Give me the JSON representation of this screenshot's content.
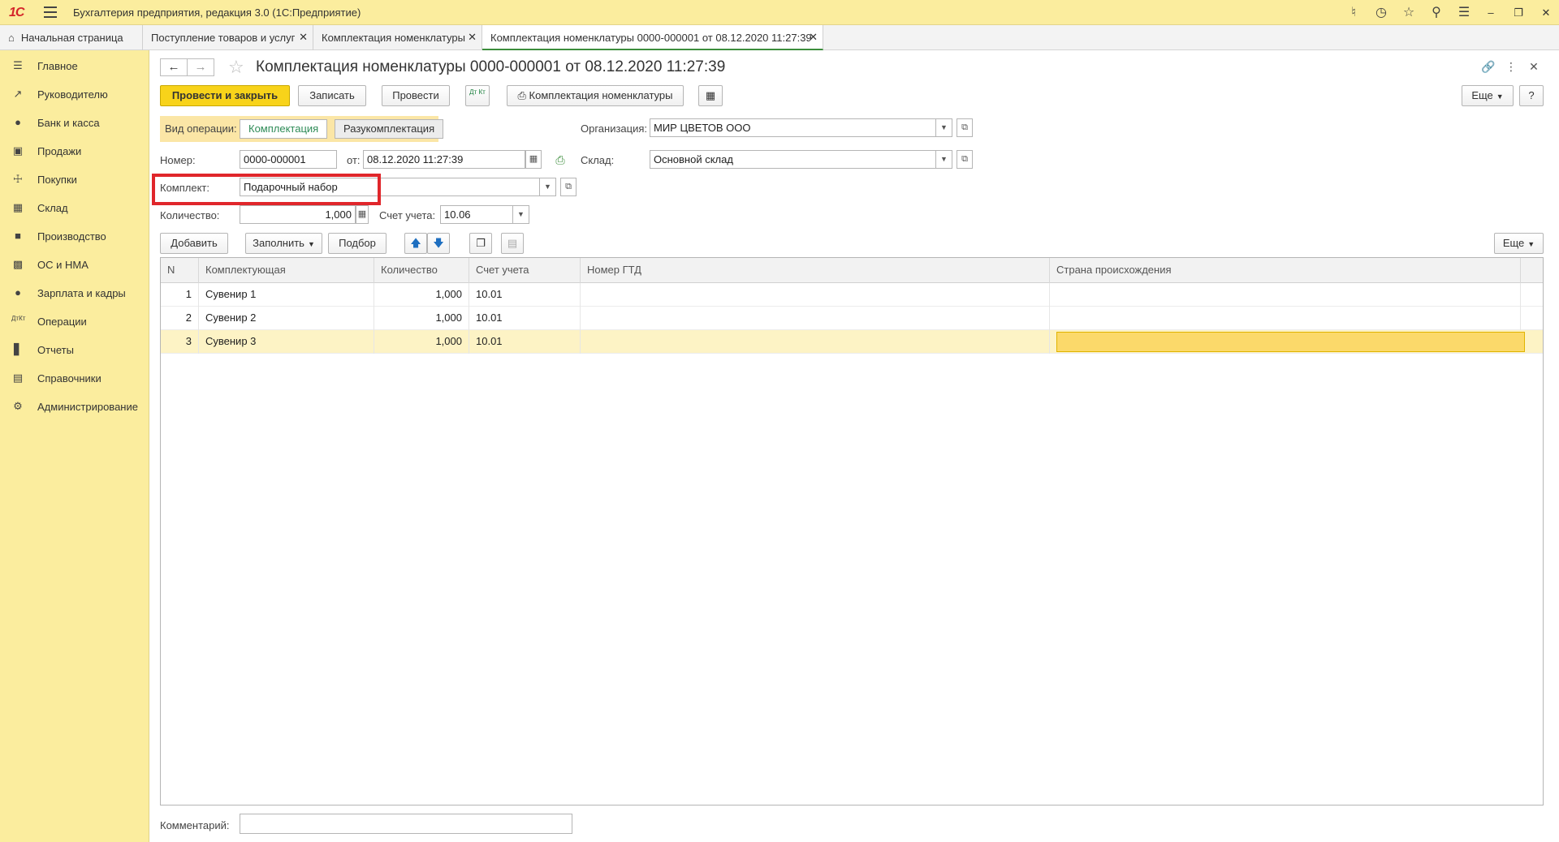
{
  "app": {
    "logo": "1С",
    "title": "Бухгалтерия предприятия, редакция 3.0  (1С:Предприятие)"
  },
  "tabs": [
    {
      "label": "Начальная страница",
      "icon": "home-icon"
    },
    {
      "label": "Поступление товаров и услуг"
    },
    {
      "label": "Комплектация номенклатуры"
    },
    {
      "label": "Комплектация номенклатуры 0000-000001 от 08.12.2020 11:27:39",
      "active": true
    }
  ],
  "sidebar": {
    "items": [
      {
        "label": "Главное",
        "icon": "list-icon"
      },
      {
        "label": "Руководителю",
        "icon": "trend-icon"
      },
      {
        "label": "Банк и касса",
        "icon": "coin-icon"
      },
      {
        "label": "Продажи",
        "icon": "bag-icon"
      },
      {
        "label": "Покупки",
        "icon": "cart-icon"
      },
      {
        "label": "Склад",
        "icon": "grid-icon"
      },
      {
        "label": "Производство",
        "icon": "factory-icon"
      },
      {
        "label": "ОС и НМА",
        "icon": "truck-icon"
      },
      {
        "label": "Зарплата и кадры",
        "icon": "person-icon"
      },
      {
        "label": "Операции",
        "icon": "dtkt-icon"
      },
      {
        "label": "Отчеты",
        "icon": "bar-chart-icon"
      },
      {
        "label": "Справочники",
        "icon": "book-icon"
      },
      {
        "label": "Администрирование",
        "icon": "gear-icon"
      }
    ]
  },
  "form": {
    "title": "Комплектация номенклатуры 0000-000001 от 08.12.2020 11:27:39",
    "toolbar": {
      "post_close": "Провести и закрыть",
      "save": "Записать",
      "post": "Провести",
      "dtkt": "Дт Кт",
      "print": "Комплектация номенклатуры",
      "more": "Еще",
      "help": "?"
    },
    "op_type": {
      "label": "Вид операции:",
      "options": [
        "Комплектация",
        "Разукомплектация"
      ],
      "selected": "Комплектация"
    },
    "organization": {
      "label": "Организация:",
      "value": "МИР ЦВЕТОВ ООО"
    },
    "number": {
      "label": "Номер:",
      "value": "0000-000001"
    },
    "date": {
      "label": "от:",
      "value": "08.12.2020 11:27:39"
    },
    "warehouse": {
      "label": "Склад:",
      "value": "Основной склад"
    },
    "kit": {
      "label": "Комплект:",
      "value": "Подарочный набор"
    },
    "quantity": {
      "label": "Количество:",
      "value": "1,000"
    },
    "account": {
      "label": "Счет учета:",
      "value": "10.06"
    },
    "table_toolbar": {
      "add": "Добавить",
      "fill": "Заполнить",
      "pick": "Подбор",
      "more": "Еще"
    },
    "comment": {
      "label": "Комментарий:",
      "value": ""
    }
  },
  "table": {
    "columns": [
      "N",
      "Комплектующая",
      "Количество",
      "Счет учета",
      "Номер ГТД",
      "Страна происхождения"
    ],
    "rows": [
      {
        "n": "1",
        "item": "Сувенир 1",
        "qty": "1,000",
        "account": "10.01",
        "gtd": "",
        "country": ""
      },
      {
        "n": "2",
        "item": "Сувенир 2",
        "qty": "1,000",
        "account": "10.01",
        "gtd": "",
        "country": ""
      },
      {
        "n": "3",
        "item": "Сувенир 3",
        "qty": "1,000",
        "account": "10.01",
        "gtd": "",
        "country": "",
        "selected": true
      }
    ]
  }
}
